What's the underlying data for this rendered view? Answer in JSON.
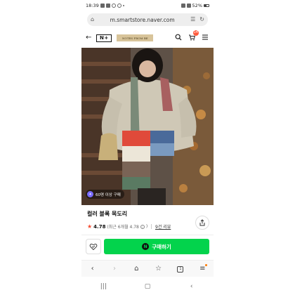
{
  "status_bar": {
    "time": "18:39",
    "battery": "52%"
  },
  "browser": {
    "url": "m.smartstore.naver.com",
    "tabs_count": "1"
  },
  "store_header": {
    "logo": "N+",
    "store_name": "NOTES FROM BE",
    "cart_count": "14"
  },
  "product": {
    "buyers_badge": "60명 이상 구매",
    "title": "컬러 블록 목도리",
    "rating": "4.78",
    "rating_note": "(최근 6개월 4.78",
    "rating_note_close": ")",
    "review_link": "9건 리뷰"
  },
  "actions": {
    "buy_label": "구매하기",
    "npay_letter": "N"
  },
  "icons": {
    "back": "back-arrow-icon",
    "search": "search-icon",
    "cart": "cart-icon",
    "menu": "hamburger-menu-icon",
    "share": "share-icon",
    "wish": "heart-check-icon",
    "star": "star-icon"
  },
  "colors": {
    "buy_button": "#03d34c",
    "star": "#f54a2e",
    "cart_badge": "#ff5a3c",
    "store_banner": "#d8c49a"
  }
}
